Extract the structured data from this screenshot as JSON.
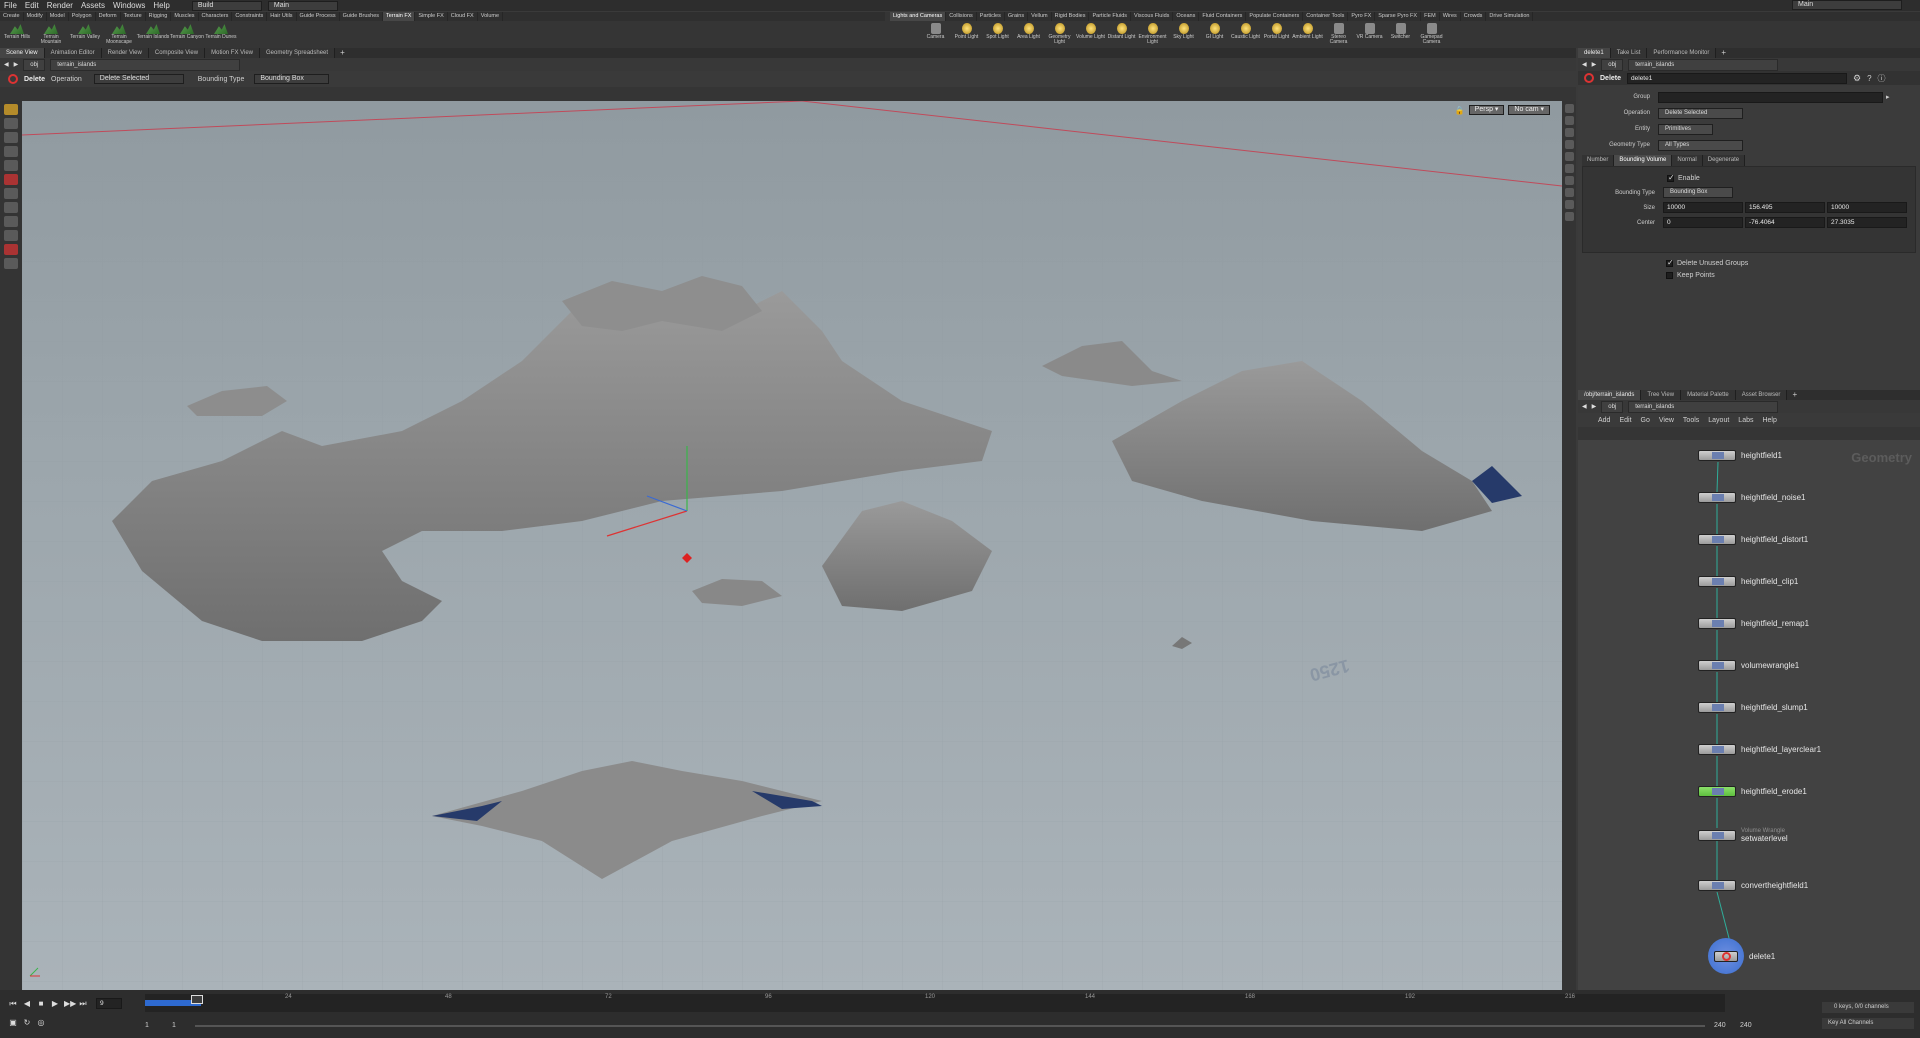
{
  "menubar": {
    "items": [
      "File",
      "Edit",
      "Render",
      "Assets",
      "Windows",
      "Help"
    ],
    "desktop": "Build",
    "context": "Main",
    "right_context": "Main"
  },
  "shelf_left": {
    "tabs": [
      "Create",
      "Modify",
      "Model",
      "Polygon",
      "Deform",
      "Texture",
      "Rigging",
      "Muscles",
      "Characters",
      "Constraints",
      "Hair Utils",
      "Guide Process",
      "Guide Brushes",
      "Terrain FX",
      "Simple FX",
      "Cloud FX",
      "Volume"
    ],
    "active_tab": "Terrain FX",
    "tools": [
      "Terrain Hills",
      "Terrain Mountain",
      "Terrain Valley",
      "Terrain Moonscape",
      "Terrain Islands",
      "Terrain Canyon",
      "Terrain Dunes"
    ]
  },
  "shelf_right": {
    "tabs": [
      "Lights and Cameras",
      "Collisions",
      "Particles",
      "Grains",
      "Vellum",
      "Rigid Bodies",
      "Particle Fluids",
      "Viscous Fluids",
      "Oceans",
      "Fluid Containers",
      "Populate Containers",
      "Container Tools",
      "Pyro FX",
      "Sparse Pyro FX",
      "FEM",
      "Wires",
      "Crowds",
      "Drive Simulation"
    ],
    "active_tab": "Lights and Cameras",
    "tools": [
      "Camera",
      "Point Light",
      "Spot Light",
      "Area Light",
      "Geometry Light",
      "Volume Light",
      "Distant Light",
      "Environment Light",
      "Sky Light",
      "GI Light",
      "Caustic Light",
      "Portal Light",
      "Ambient Light",
      "Stereo Camera",
      "VR Camera",
      "Switcher",
      "Gamepad Camera"
    ]
  },
  "left_pane": {
    "tabs": [
      "Scene View",
      "Animation Editor",
      "Render View",
      "Composite View",
      "Motion FX View",
      "Geometry Spreadsheet"
    ],
    "path_root": "obj",
    "path_node": "terrain_islands",
    "op_name": "Delete",
    "op_label": "Operation",
    "op_value": "Delete Selected",
    "bt_label": "Bounding Type",
    "bt_value": "Bounding Box",
    "persp": "Persp ▾",
    "cam": "No cam ▾",
    "axis_text": "1250"
  },
  "right_top": {
    "tabs": [
      "delete1",
      "Take List",
      "Performance Monitor"
    ],
    "path_root": "obj",
    "path_node": "terrain_islands",
    "node_type": "Delete",
    "node_name": "delete1",
    "group_label": "Group",
    "operation_label": "Operation",
    "operation_value": "Delete Selected",
    "entity_label": "Entity",
    "entity_value": "Primitives",
    "geotype_label": "Geometry Type",
    "geotype_value": "All Types",
    "subtabs": [
      "Number",
      "Bounding Volume",
      "Normal",
      "Degenerate"
    ],
    "active_subtab": "Bounding Volume",
    "enable_label": "Enable",
    "btype_label": "Bounding Type",
    "btype_value": "Bounding Box",
    "size_label": "Size",
    "size": [
      "10000",
      "156.495",
      "10000"
    ],
    "center_label": "Center",
    "center": [
      "0",
      "-76.4064",
      "27.3035"
    ],
    "delete_unused_label": "Delete Unused Groups",
    "keep_points_label": "Keep Points"
  },
  "network": {
    "tabs": [
      "/obj/terrain_islands",
      "Tree View",
      "Material Palette",
      "Asset Browser"
    ],
    "path_root": "obj",
    "path_node": "terrain_islands",
    "menu": [
      "Add",
      "Edit",
      "Go",
      "View",
      "Tools",
      "Layout",
      "Labs",
      "Help"
    ],
    "watermark": "Geometry",
    "nodes": [
      {
        "name": "heightfield1",
        "sub": ""
      },
      {
        "name": "heightfield_noise1",
        "sub": ""
      },
      {
        "name": "heightfield_distort1",
        "sub": ""
      },
      {
        "name": "heightfield_clip1",
        "sub": ""
      },
      {
        "name": "heightfield_remap1",
        "sub": ""
      },
      {
        "name": "volumewrangle1",
        "sub": ""
      },
      {
        "name": "heightfield_slump1",
        "sub": ""
      },
      {
        "name": "heightfield_layerclear1",
        "sub": ""
      },
      {
        "name": "heightfield_erode1",
        "sub": ""
      },
      {
        "name": "setwaterlevel",
        "sub": "Volume Wrangle"
      },
      {
        "name": "convertheightfield1",
        "sub": ""
      },
      {
        "name": "delete1",
        "sub": ""
      }
    ]
  },
  "timeline": {
    "frame": "9",
    "ticks": [
      "24",
      "48",
      "72",
      "96",
      "120",
      "144",
      "168",
      "192",
      "216"
    ],
    "start": "1",
    "start2": "1",
    "end": "240",
    "end2": "240",
    "keys": "0 keys, 0/0 channels",
    "key_all": "Key All Channels"
  },
  "colors": {
    "accent": "#ff9900",
    "viewport_top": "#8f999f",
    "viewport_bottom": "#abb4ba",
    "erode_node": "#5fbf3f",
    "delete_ring": "#3b6fd0"
  }
}
